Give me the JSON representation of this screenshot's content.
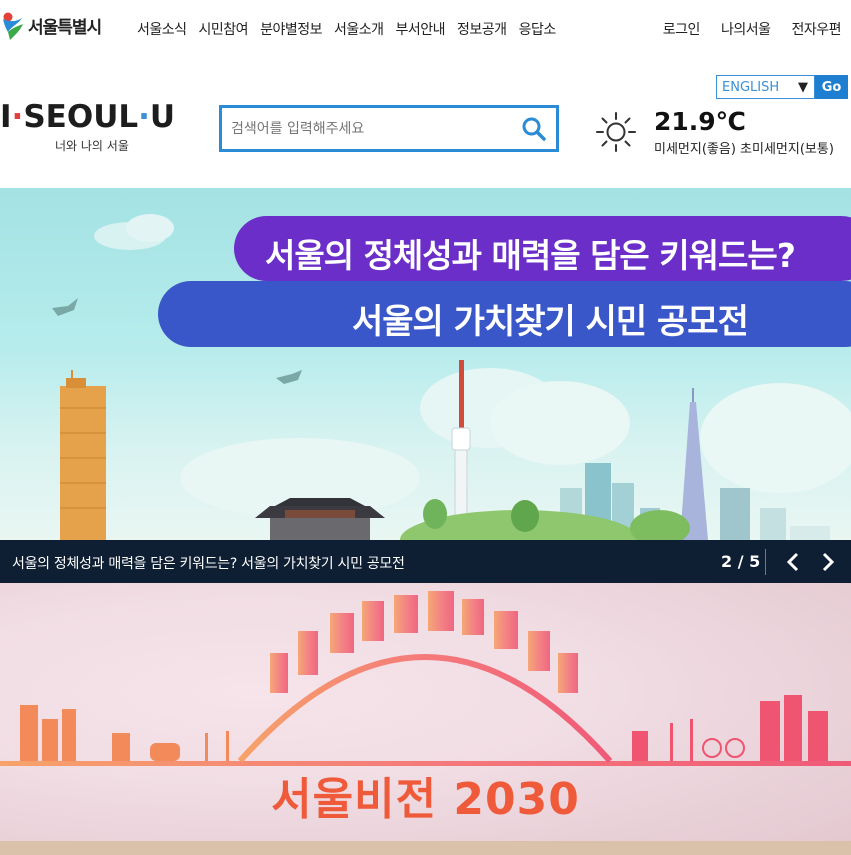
{
  "logo": {
    "text": "서울특별시"
  },
  "gnb": [
    "서울소식",
    "시민참여",
    "분야별정보",
    "서울소개",
    "부서안내",
    "정보공개",
    "응답소"
  ],
  "util": [
    "로그인",
    "나의서울",
    "전자우편"
  ],
  "language": {
    "selected": "ENGLISH",
    "go_label": "Go"
  },
  "brand": {
    "main_left": "I",
    "main_mid": "SE",
    "main_o": "O",
    "main_ul": "UL",
    "main_u": "U",
    "sub": "너와 나의 서울"
  },
  "search": {
    "placeholder": "검색어를 입력해주세요"
  },
  "weather": {
    "temperature": "21.9℃",
    "dust": "미세먼지(좋음) 초미세먼지(보통)"
  },
  "banner": {
    "line1": "서울의 정체성과 매력을 담은 키워드는?",
    "line2": "서울의 가치찾기 시민 공모전",
    "caption": "서울의 정체성과 매력을 담은 키워드는? 서울의 가치찾기 시민 공모전",
    "pager": "2 / 5"
  },
  "vision": {
    "title": "서울비전 2030"
  },
  "colors": {
    "accent": "#2a8bd6",
    "purple": "#6b2ec9",
    "blue": "#3a57c9",
    "caption_bg": "#0e1e33",
    "vision_text": "#ee5a3a"
  }
}
